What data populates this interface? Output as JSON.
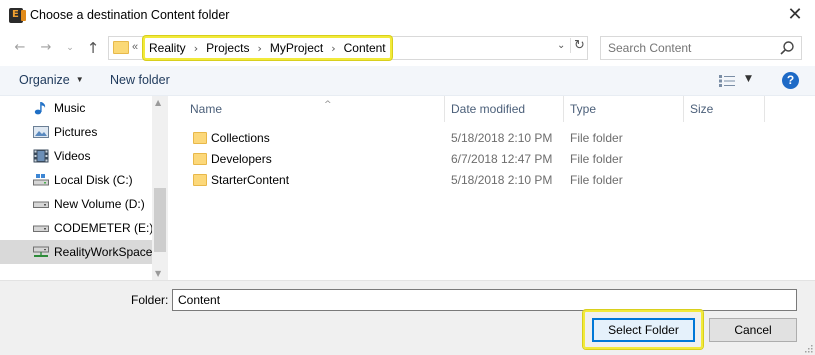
{
  "window": {
    "title": "Choose a destination Content folder",
    "close_glyph": "✕",
    "app_icon_letter": "E"
  },
  "navigation": {
    "back_glyph": "←",
    "forward_glyph": "→",
    "history_glyph": "⌄",
    "up_glyph": "↑"
  },
  "address": {
    "overflow_glyph": "«",
    "crumbs": [
      "Reality",
      "Projects",
      "MyProject",
      "Content"
    ],
    "separator": "›",
    "dropdown_glyph": "⌄",
    "refresh_glyph": "↻"
  },
  "search": {
    "placeholder": "Search Content"
  },
  "toolbar": {
    "organize_label": "Organize",
    "organize_caret": "▼",
    "new_folder_label": "New folder",
    "view_caret": "▼",
    "help_label": "?"
  },
  "sidebar": {
    "items": [
      {
        "label": "Music",
        "icon": "music-icon"
      },
      {
        "label": "Pictures",
        "icon": "pictures-icon"
      },
      {
        "label": "Videos",
        "icon": "videos-icon"
      },
      {
        "label": "Local Disk (C:)",
        "icon": "local-disk-icon"
      },
      {
        "label": "New Volume (D:)",
        "icon": "drive-icon"
      },
      {
        "label": "CODEMETER (E:)",
        "icon": "drive-icon"
      },
      {
        "label": "RealityWorkSpace",
        "icon": "network-drive-icon",
        "selected": true
      }
    ],
    "scroll_up_glyph": "▲",
    "scroll_down_glyph": "▼"
  },
  "file_list": {
    "columns": {
      "name": "Name",
      "date": "Date modified",
      "type": "Type",
      "size": "Size"
    },
    "sort_glyph": "^",
    "rows": [
      {
        "name": "Collections",
        "date": "5/18/2018 2:10 PM",
        "type": "File folder"
      },
      {
        "name": "Developers",
        "date": "6/7/2018 12:47 PM",
        "type": "File folder"
      },
      {
        "name": "StarterContent",
        "date": "5/18/2018 2:10 PM",
        "type": "File folder"
      }
    ]
  },
  "footer": {
    "folder_label": "Folder:",
    "folder_value": "Content",
    "select_button": "Select Folder",
    "cancel_button": "Cancel"
  },
  "colors": {
    "highlight": "#f2ea3a",
    "accent": "#0078d7",
    "folder": "#fcd87a"
  }
}
